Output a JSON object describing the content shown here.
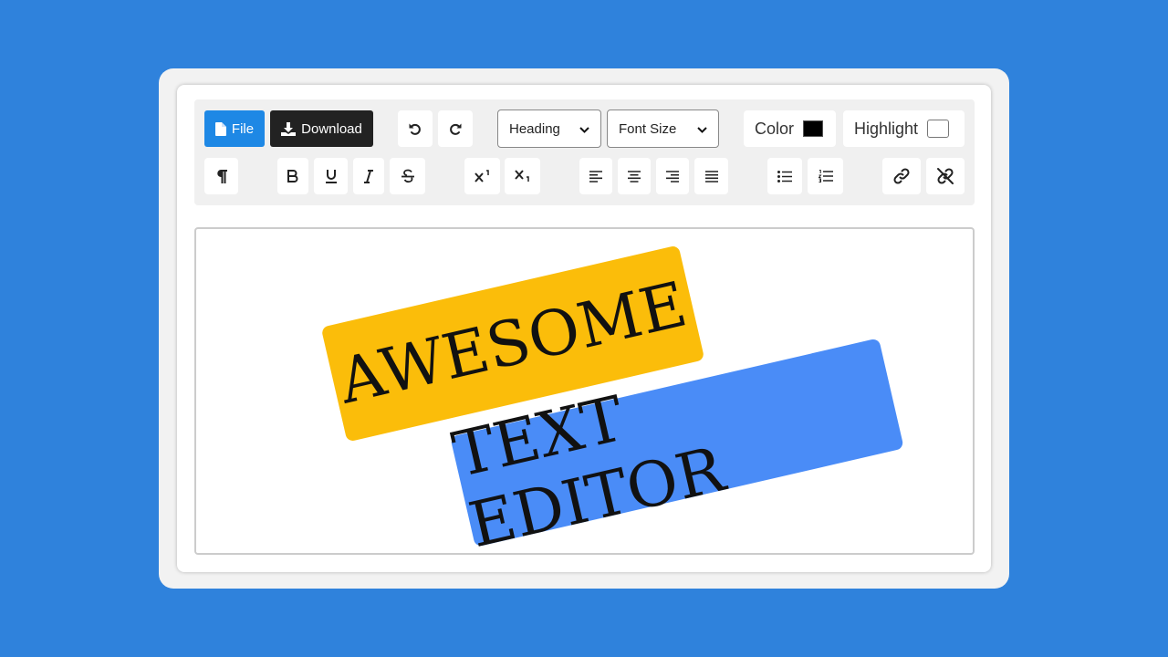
{
  "toolbar": {
    "file_label": "File",
    "download_label": "Download",
    "heading_select": "Heading",
    "font_size_select": "Font Size",
    "color_label": "Color",
    "highlight_label": "Highlight",
    "colors": {
      "text_color": "#000000",
      "highlight_color": "#ffffff",
      "file_button": "#1e88e5",
      "download_button": "#222222"
    }
  },
  "editor": {
    "banner_top": "AWESOME",
    "banner_bottom": "TEXT EDITOR",
    "colors": {
      "banner_top": "#fbbd0a",
      "banner_bottom": "#4a8cf7",
      "page_background": "#2f82dc"
    }
  }
}
